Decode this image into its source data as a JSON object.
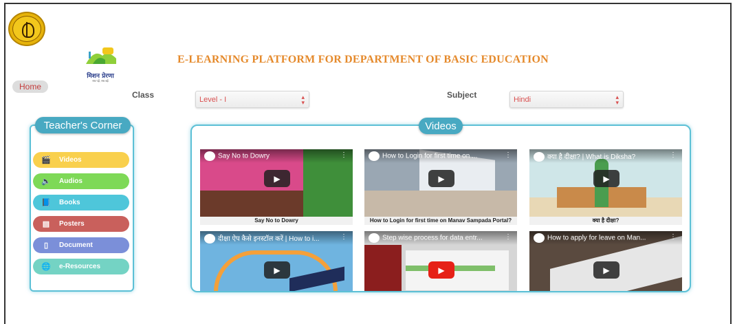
{
  "header": {
    "title": "E-LEARNING PLATFORM FOR DEPARTMENT OF BASIC EDUCATION",
    "mission_logo_text": "मिशन प्रेरणा",
    "mission_logo_tagline": "सब पढ़ें, सब बढ़ें"
  },
  "nav": {
    "home_label": "Home"
  },
  "filters": {
    "class_label": "Class",
    "class_value": "Level - I",
    "subject_label": "Subject",
    "subject_value": "Hindi"
  },
  "teacher_corner": {
    "title": "Teacher's Corner",
    "items": [
      {
        "label": "Videos",
        "icon": "clapperboard-icon",
        "color": "#f9d04d"
      },
      {
        "label": "Audios",
        "icon": "speaker-icon",
        "color": "#7ed957"
      },
      {
        "label": "Books",
        "icon": "book-icon",
        "color": "#4ec6da"
      },
      {
        "label": "Posters",
        "icon": "poster-icon",
        "color": "#c9605c"
      },
      {
        "label": "Document",
        "icon": "document-icon",
        "color": "#7b8fd9"
      },
      {
        "label": "e-Resources",
        "icon": "globe-icon",
        "color": "#74d3c4"
      }
    ]
  },
  "videos": {
    "title": "Videos",
    "items": [
      {
        "overlay_title": "Say No to Dowry",
        "caption": "Say No to Dowry",
        "bg": "#d94a8a"
      },
      {
        "overlay_title": "How to Login for first time on ...",
        "caption": "How to Login for first time on Manav Sampada Portal?",
        "bg": "#9aa7b3"
      },
      {
        "overlay_title": "क्या है दीक्षा? | What is Diksha?",
        "caption": "क्या है दीक्षा?",
        "bg": "#cfe6e8"
      },
      {
        "overlay_title": "दीक्षा ऐप कैसे इनस्टॉल करें | How to i...",
        "caption": "",
        "bg": "#6fb4e0"
      },
      {
        "overlay_title": "Step wise process for data entr...",
        "caption": "",
        "bg": "#c9c9c9"
      },
      {
        "overlay_title": "How to apply for leave on Man...",
        "caption": "",
        "bg": "#5a4a3f"
      }
    ]
  }
}
